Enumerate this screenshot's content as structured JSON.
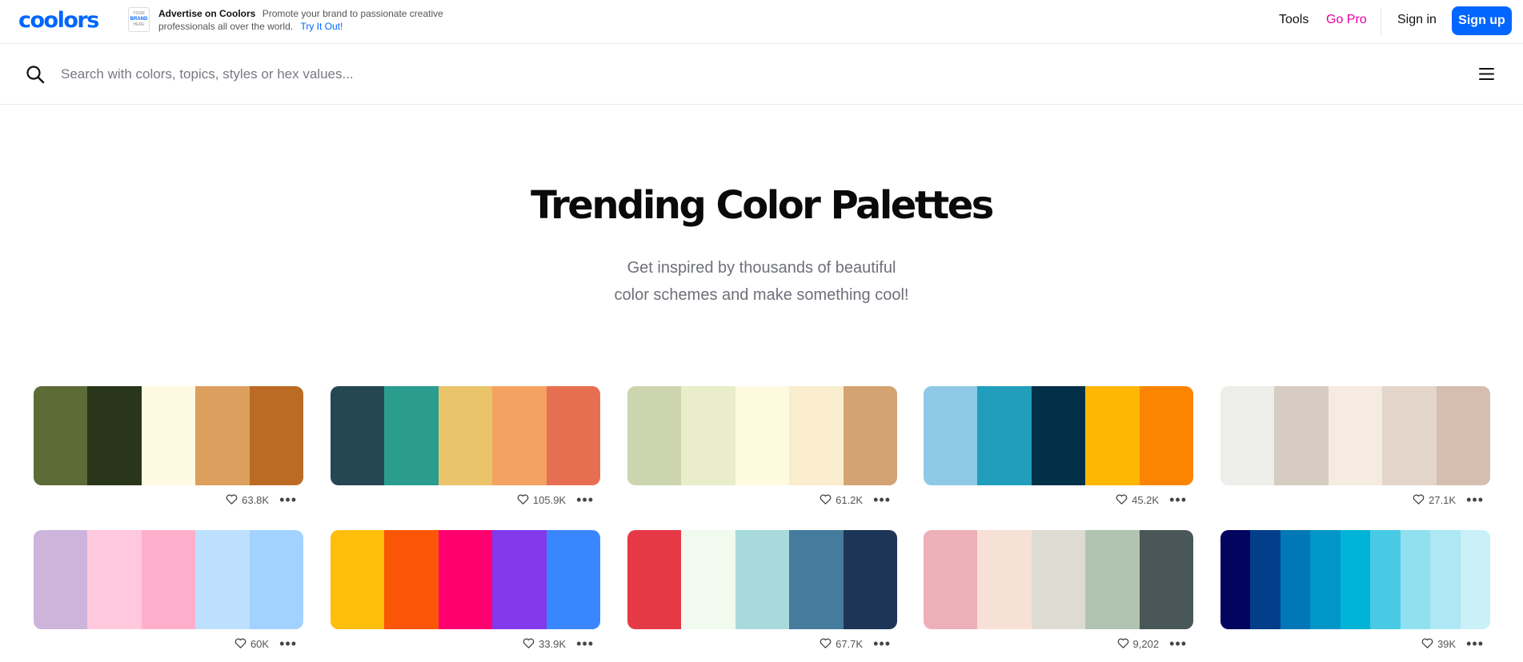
{
  "brand": {
    "logo": "coolors",
    "accent": "#0066ff"
  },
  "ad": {
    "image_top": "YOUR",
    "image_mid": "BRAND",
    "image_bottom": "HERE",
    "title": "Advertise on Coolors",
    "body": "Promote your brand to passionate creative professionals all over the world.",
    "cta": "Try It Out!"
  },
  "nav": {
    "tools": "Tools",
    "go_pro": "Go Pro",
    "sign_in": "Sign in",
    "sign_up": "Sign up"
  },
  "search": {
    "placeholder": "Search with colors, topics, styles or hex values...",
    "value": ""
  },
  "hero": {
    "title": "Trending Color Palettes",
    "subtitle_line1": "Get inspired by thousands of beautiful",
    "subtitle_line2": "color schemes and make something cool!"
  },
  "palettes": [
    {
      "colors": [
        "#5d6b37",
        "#29361a",
        "#fef9e1",
        "#dc9f5e",
        "#bb6b24"
      ],
      "likes": "63.8K"
    },
    {
      "colors": [
        "#254653",
        "#2a9d8f",
        "#e9c46a",
        "#f4a261",
        "#e76f51"
      ],
      "likes": "105.9K"
    },
    {
      "colors": [
        "#ccd5ae",
        "#e9edc9",
        "#fefae0",
        "#faedcd",
        "#d4a373"
      ],
      "likes": "61.2K"
    },
    {
      "colors": [
        "#8ecae6",
        "#219ebc",
        "#023047",
        "#ffb703",
        "#fb8500"
      ],
      "likes": "45.2K"
    },
    {
      "colors": [
        "#edede9",
        "#d6ccc2",
        "#f5ebe0",
        "#e3d5ca",
        "#d5bdaf"
      ],
      "likes": "27.1K"
    },
    {
      "colors": [
        "#cdb4db",
        "#ffc8dd",
        "#ffafcc",
        "#bde0fe",
        "#a2d2ff"
      ],
      "likes": "60K"
    },
    {
      "colors": [
        "#ffbe0b",
        "#fb5607",
        "#ff006e",
        "#8338ec",
        "#3a86ff"
      ],
      "likes": "33.9K"
    },
    {
      "colors": [
        "#e63946",
        "#f1faee",
        "#a8dadc",
        "#457b9d",
        "#1d3557"
      ],
      "likes": "67.7K"
    },
    {
      "colors": [
        "#edafb8",
        "#f7e1d7",
        "#dedbd2",
        "#b0c4b1",
        "#4a5759"
      ],
      "likes": "9,202"
    },
    {
      "colors": [
        "#03045e",
        "#023e8a",
        "#0077b6",
        "#0096c7",
        "#00b4d8",
        "#48cae4",
        "#90e0ef",
        "#ade8f4",
        "#caf0f8"
      ],
      "likes": "39K"
    }
  ]
}
